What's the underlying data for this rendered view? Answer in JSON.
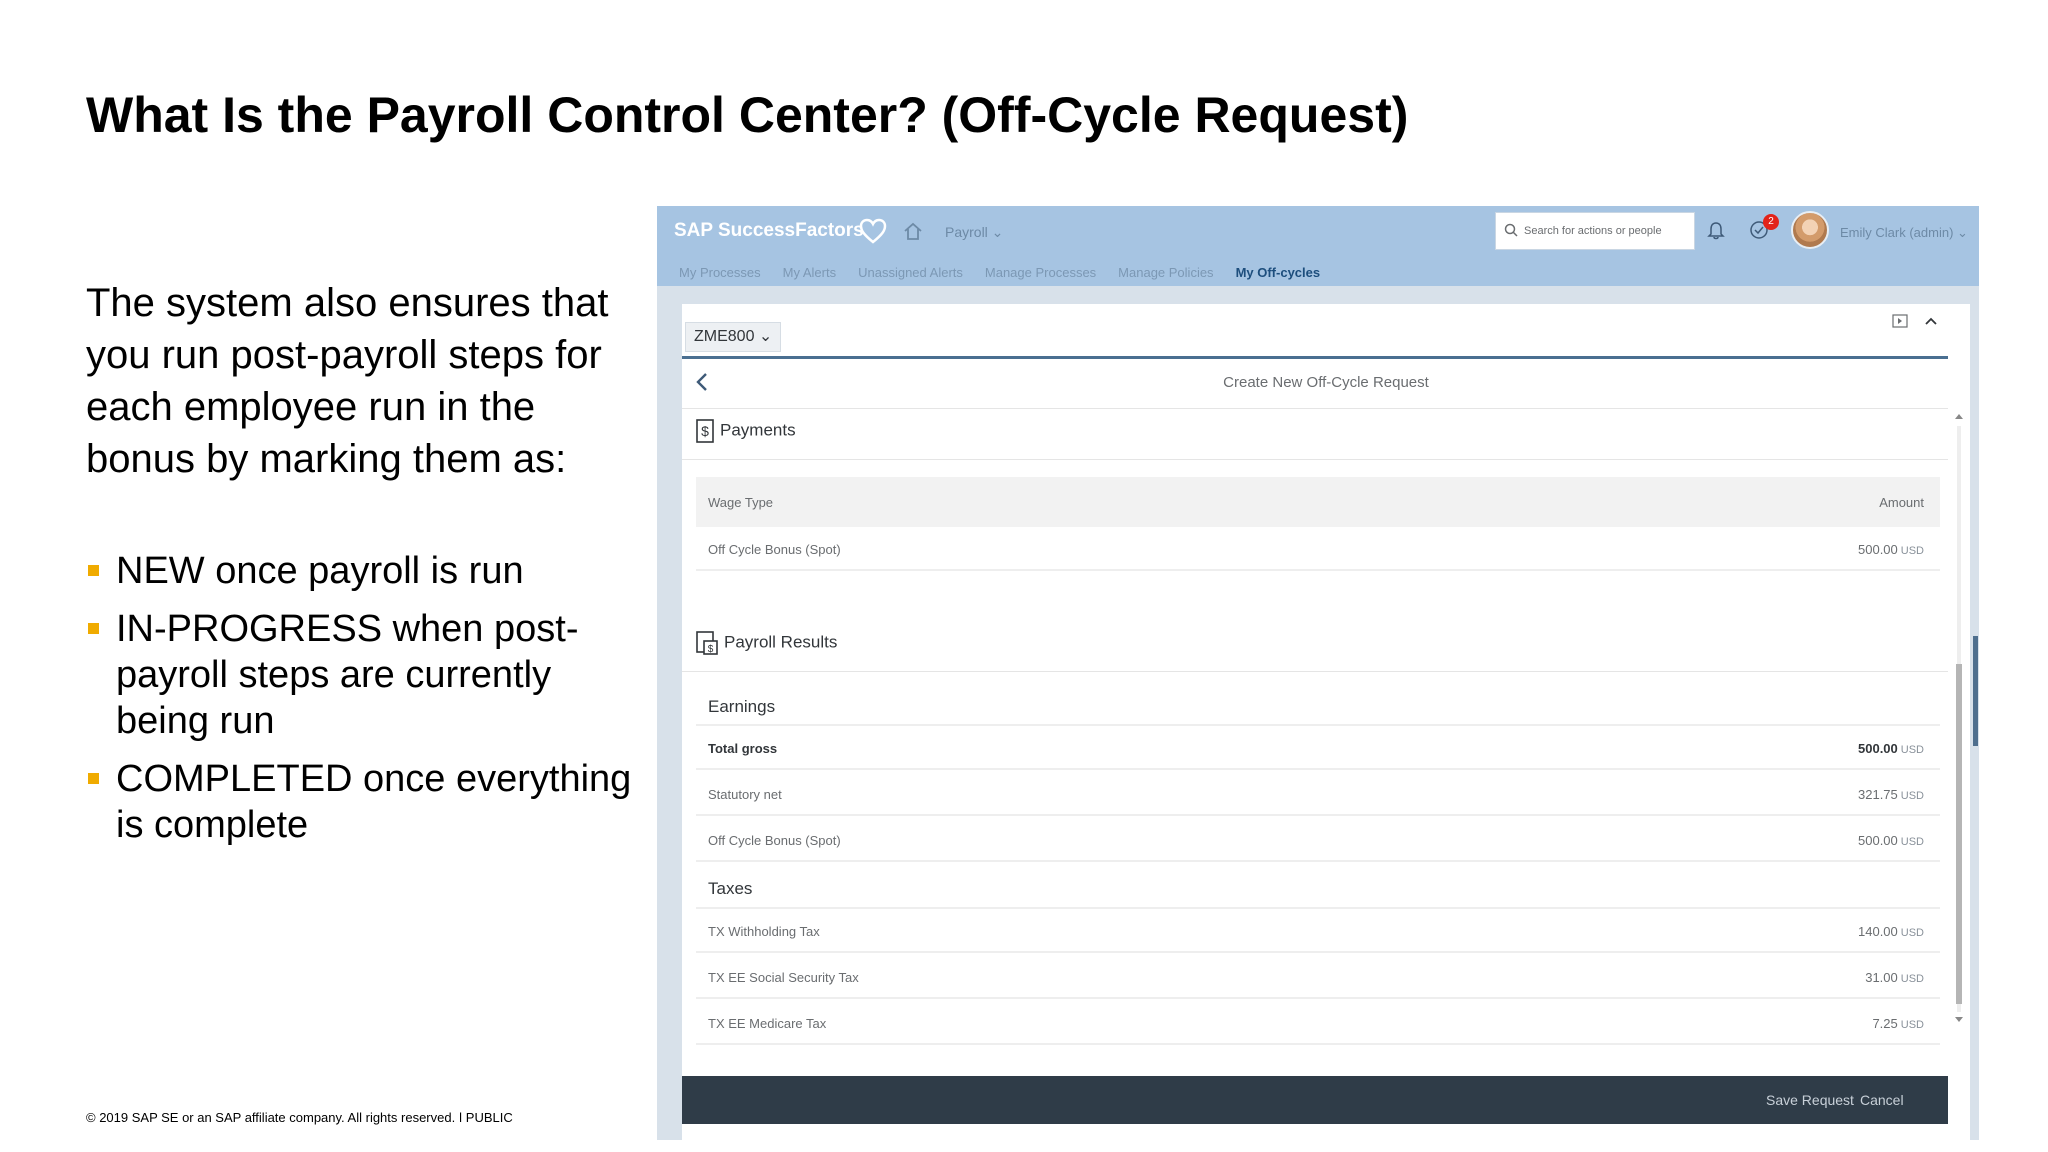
{
  "slide": {
    "title": "What Is the Payroll Control Center? (Off-Cycle Request)",
    "intro": "The system also ensures that you run post-payroll steps for each employee run in the bonus by marking them as:",
    "bullets": [
      "NEW once payroll is run",
      "IN-PROGRESS when post-payroll steps are currently being run",
      "COMPLETED once everything is complete"
    ],
    "footer": "© 2019 SAP SE or an SAP affiliate company. All rights reserved.  ǀ  PUBLIC",
    "bullet_color": "#f0ab00"
  },
  "app": {
    "logo": "SAP SuccessFactors",
    "module": "Payroll ⌄",
    "search_placeholder": "Search for actions or people",
    "notification_count": "2",
    "user": "Emily Clark (admin) ⌄",
    "tabs": [
      "My Processes",
      "My Alerts",
      "Unassigned Alerts",
      "Manage Processes",
      "Manage Policies",
      "My Off-cycles"
    ],
    "active_tab": "My Off-cycles",
    "employee": "ZME800 ⌄",
    "form_title": "Create New Off-Cycle Request",
    "payments": {
      "heading": "Payments",
      "col_wage_type": "Wage Type",
      "col_amount": "Amount",
      "rows": [
        {
          "label": "Off Cycle Bonus (Spot)",
          "amount": "500.00",
          "currency": "USD"
        }
      ]
    },
    "results": {
      "heading": "Payroll Results",
      "earnings_label": "Earnings",
      "earnings": [
        {
          "label": "Total gross",
          "amount": "500.00",
          "currency": "USD"
        },
        {
          "label": "Statutory net",
          "amount": "321.75",
          "currency": "USD"
        },
        {
          "label": "Off Cycle Bonus (Spot)",
          "amount": "500.00",
          "currency": "USD"
        }
      ],
      "taxes_label": "Taxes",
      "taxes": [
        {
          "label": "TX Withholding Tax",
          "amount": "140.00",
          "currency": "USD"
        },
        {
          "label": "TX EE Social Security Tax",
          "amount": "31.00",
          "currency": "USD"
        },
        {
          "label": "TX EE Medicare Tax",
          "amount": "7.25",
          "currency": "USD"
        }
      ]
    },
    "actions": {
      "save": "Save Request",
      "cancel": "Cancel"
    },
    "colors": {
      "shellbar": "#a6c4e2",
      "action_bar": "#2f3c48",
      "badge": "#e2231a"
    }
  }
}
